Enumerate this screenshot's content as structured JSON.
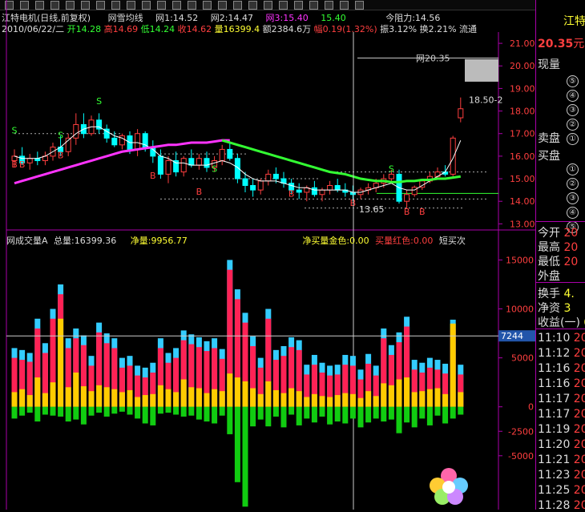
{
  "toolbar": {
    "button_count": 24
  },
  "header": {
    "stock_name": "江特电机(日线,前复权)",
    "indicator_name": "网雪均线",
    "w1": "网1:14.52",
    "w2": "网2:14.47",
    "w3": "网3:15.40",
    "w4": "15.40",
    "resist": "今阻力:14.56",
    "date": "2010/06/22/二",
    "open": "开14.28",
    "high": "高14.69",
    "low": "低14.24",
    "close": "收14.62",
    "volume": "量16399.4",
    "amount": "额2384.6万",
    "change": "幅0.19(1.32%)",
    "amplitude": "振3.12%",
    "turnover": "换2.21%",
    "flow": "流通"
  },
  "lower_header": {
    "name": "网成交量A",
    "total": "总量:16399.36",
    "net": "净量:9956.77",
    "buy": "净买量金色:0.00",
    "sell": "买量红色:0.00",
    "short": "短买次"
  },
  "right_panel": {
    "title": "江特",
    "price": "20.35",
    "unit": "元",
    "now_vol": "现量",
    "ask": "卖盘",
    "bid": "买盘",
    "levels": [
      "⑤",
      "④",
      "③",
      "②",
      "①"
    ],
    "bid_levels": [
      "①",
      "②",
      "③",
      "④",
      "⑤"
    ],
    "today_open": "今开",
    "today_open_v": "20",
    "high": "最高",
    "high_v": "20",
    "low": "最低",
    "low_v": "20",
    "outer": "外盘",
    "outer_v": "",
    "turnover": "换手",
    "turnover_v": "4.",
    "netasset": "净资",
    "netasset_v": "3",
    "earn": "收益(一)",
    "earn_v": "0",
    "ticks": [
      "11:10",
      "11:12",
      "11:16",
      "11:16",
      "11:17",
      "11:17",
      "11:19",
      "11:20",
      "11:21",
      "11:23",
      "11:25",
      "11:28"
    ],
    "tick_vals": [
      "20",
      "20",
      "20",
      "20",
      "20",
      "20",
      "20",
      "20",
      "20",
      "20",
      "20",
      "20"
    ]
  },
  "colors": {
    "up": "#ff3f3f",
    "down": "#00ffff",
    "ma_green": "#33ff33",
    "ma_magenta": "#ff33ff",
    "vol_cyan": "#33ccff",
    "vol_red": "#ff2255",
    "vol_gold": "#ffcc00",
    "vol_green": "#11cc11"
  },
  "chart_data": [
    {
      "type": "candlestick",
      "title": "江特电机(日线,前复权)",
      "ylim": [
        12.8,
        21.5
      ],
      "y_ticks": [
        13.0,
        14.0,
        15.0,
        16.0,
        17.0,
        18.0,
        19.0,
        20.0,
        21.0
      ],
      "annotations": [
        "网20.35",
        "18.50-2",
        "13.65"
      ],
      "candles": [
        [
          15.8,
          16.3,
          15.5,
          16.0
        ],
        [
          16.0,
          16.4,
          15.6,
          15.7
        ],
        [
          15.7,
          16.1,
          15.4,
          15.9
        ],
        [
          15.9,
          16.2,
          15.6,
          15.8
        ],
        [
          15.8,
          16.2,
          15.6,
          16.0
        ],
        [
          16.0,
          16.6,
          15.8,
          16.4
        ],
        [
          16.4,
          16.9,
          16.0,
          16.2
        ],
        [
          16.2,
          17.0,
          16.0,
          16.8
        ],
        [
          16.8,
          17.9,
          16.5,
          17.4
        ],
        [
          17.4,
          17.9,
          16.8,
          17.0
        ],
        [
          17.0,
          17.8,
          16.9,
          17.6
        ],
        [
          17.6,
          17.9,
          17.0,
          17.2
        ],
        [
          17.2,
          17.4,
          16.6,
          16.8
        ],
        [
          16.8,
          17.1,
          16.4,
          16.5
        ],
        [
          16.5,
          17.0,
          16.3,
          16.9
        ],
        [
          16.9,
          17.1,
          16.1,
          16.3
        ],
        [
          16.3,
          17.2,
          16.0,
          17.0
        ],
        [
          17.0,
          17.1,
          16.2,
          16.4
        ],
        [
          16.4,
          16.7,
          15.7,
          16.0
        ],
        [
          16.0,
          16.3,
          15.0,
          15.2
        ],
        [
          15.2,
          16.0,
          14.8,
          15.8
        ],
        [
          15.8,
          16.2,
          15.1,
          15.3
        ],
        [
          15.3,
          16.0,
          15.1,
          15.9
        ],
        [
          15.9,
          16.3,
          15.5,
          15.6
        ],
        [
          15.6,
          16.1,
          15.4,
          15.9
        ],
        [
          15.9,
          16.2,
          15.3,
          15.5
        ],
        [
          15.5,
          16.0,
          15.3,
          15.8
        ],
        [
          15.8,
          16.5,
          15.6,
          16.3
        ],
        [
          16.3,
          16.6,
          15.8,
          15.9
        ],
        [
          15.9,
          16.1,
          14.8,
          15.0
        ],
        [
          15.0,
          15.3,
          14.4,
          14.7
        ],
        [
          14.7,
          15.0,
          14.2,
          14.5
        ],
        [
          14.5,
          15.0,
          14.3,
          14.9
        ],
        [
          14.9,
          15.4,
          14.7,
          15.2
        ],
        [
          15.2,
          15.5,
          14.8,
          15.0
        ],
        [
          15.0,
          15.3,
          14.6,
          14.8
        ],
        [
          14.8,
          15.0,
          14.3,
          14.5
        ],
        [
          14.5,
          14.8,
          14.1,
          14.4
        ],
        [
          14.4,
          14.7,
          14.0,
          14.6
        ],
        [
          14.6,
          14.9,
          14.2,
          14.3
        ],
        [
          14.3,
          14.6,
          14.0,
          14.5
        ],
        [
          14.5,
          14.9,
          14.3,
          14.7
        ],
        [
          14.7,
          15.0,
          14.4,
          14.5
        ],
        [
          14.5,
          14.8,
          14.2,
          14.4
        ],
        [
          14.4,
          14.7,
          14.0,
          14.3
        ],
        [
          14.3,
          14.6,
          14.1,
          14.5
        ],
        [
          14.5,
          14.8,
          14.3,
          14.6
        ],
        [
          14.6,
          15.0,
          14.4,
          14.8
        ],
        [
          14.8,
          15.2,
          14.6,
          15.0
        ],
        [
          15.0,
          15.4,
          14.8,
          15.2
        ],
        [
          15.2,
          15.4,
          13.9,
          14.0
        ],
        [
          14.0,
          14.5,
          13.65,
          14.3
        ],
        [
          14.3,
          14.7,
          14.2,
          14.62
        ],
        [
          14.62,
          15.0,
          14.5,
          14.9
        ],
        [
          14.9,
          15.3,
          14.8,
          15.1
        ],
        [
          15.1,
          15.5,
          15.0,
          15.3
        ],
        [
          15.3,
          15.6,
          15.1,
          15.2
        ],
        [
          15.2,
          16.9,
          15.1,
          16.8
        ],
        [
          17.7,
          18.6,
          17.5,
          18.1
        ]
      ],
      "ma_white": [
        16.0,
        15.9,
        15.9,
        15.9,
        16.0,
        16.2,
        16.4,
        16.7,
        17.0,
        17.2,
        17.3,
        17.3,
        17.1,
        16.9,
        16.8,
        16.6,
        16.6,
        16.5,
        16.3,
        16.0,
        15.9,
        15.7,
        15.7,
        15.6,
        15.6,
        15.6,
        15.7,
        15.8,
        15.7,
        15.5,
        15.2,
        15.0,
        14.9,
        14.9,
        14.9,
        14.8,
        14.7,
        14.6,
        14.6,
        14.5,
        14.5,
        14.5,
        14.5,
        14.5,
        14.4,
        14.4,
        14.5,
        14.6,
        14.7,
        14.8,
        14.6,
        14.5,
        14.5,
        14.7,
        14.9,
        15.1,
        15.3,
        15.9,
        16.7
      ],
      "ma_magenta": [
        14.8,
        14.9,
        15.0,
        15.1,
        15.2,
        15.3,
        15.4,
        15.5,
        15.6,
        15.7,
        15.8,
        15.9,
        16.0,
        16.1,
        16.2,
        16.25,
        16.3,
        16.35,
        16.4,
        16.45,
        16.5,
        16.5,
        16.55,
        16.6,
        16.6,
        16.6,
        16.65,
        16.7,
        16.7
      ],
      "ma_green": [
        16.7,
        16.6,
        16.5,
        16.4,
        16.3,
        16.2,
        16.1,
        16.0,
        15.9,
        15.8,
        15.7,
        15.6,
        15.5,
        15.4,
        15.3,
        15.25,
        15.2,
        15.1,
        15.0,
        14.95,
        14.9,
        14.9,
        14.85,
        14.85,
        14.9,
        14.9,
        14.95,
        14.95,
        15.0,
        15.0,
        15.05,
        15.1
      ],
      "signals_S": [
        [
          0,
          17.0
        ],
        [
          11,
          18.3
        ],
        [
          6,
          16.8
        ],
        [
          26,
          15.3
        ],
        [
          49,
          15.3
        ]
      ],
      "signals_B": [
        [
          0,
          15.5
        ],
        [
          1,
          15.5
        ],
        [
          6,
          15.9
        ],
        [
          18,
          15.0
        ],
        [
          24,
          14.3
        ],
        [
          36,
          14.2
        ],
        [
          44,
          13.8
        ],
        [
          51,
          13.4
        ],
        [
          53,
          13.4
        ]
      ]
    },
    {
      "type": "bar",
      "title": "网成交量A",
      "ylim": [
        -10500,
        17000
      ],
      "y_ticks": [
        15000,
        10000,
        5000,
        0,
        -2500,
        -5000
      ],
      "highlight_label": "7244",
      "cyan": [
        6000,
        5800,
        5500,
        9000,
        6500,
        10000,
        12500,
        7000,
        8000,
        7300,
        5200,
        8600,
        7500,
        7000,
        5000,
        5200,
        4200,
        4000,
        4500,
        7000,
        5500,
        6000,
        7800,
        7400,
        7100,
        6700,
        7000,
        5900,
        15000,
        12000,
        9600,
        7200,
        5000,
        10000,
        5800,
        6200,
        7100,
        6800,
        4300,
        5300,
        4500,
        4200,
        4300,
        5300,
        5200,
        3800,
        5400,
        4200,
        8000,
        6300,
        7600,
        9200,
        4800,
        4500,
        5000,
        4800,
        4400,
        8900,
        4300
      ],
      "red": [
        5000,
        4800,
        4600,
        8000,
        5500,
        9000,
        11500,
        6000,
        7000,
        6300,
        4200,
        7600,
        6500,
        6000,
        4000,
        4200,
        3200,
        3000,
        3500,
        6000,
        4500,
        5000,
        6800,
        6400,
        6100,
        5700,
        6000,
        4900,
        14000,
        11000,
        8600,
        6200,
        4000,
        9000,
        4800,
        5200,
        6100,
        5800,
        3300,
        4300,
        3500,
        3200,
        3300,
        4300,
        4200,
        2800,
        4400,
        3200,
        7000,
        5300,
        6600,
        8200,
        3800,
        3500,
        4000,
        3800,
        3400,
        7900,
        3300
      ],
      "gold": [
        1500,
        1800,
        1200,
        3000,
        1400,
        2500,
        9000,
        2000,
        3500,
        2100,
        1600,
        2200,
        2000,
        1800,
        1500,
        1700,
        1000,
        1200,
        1300,
        2200,
        1800,
        1500,
        2800,
        2000,
        1900,
        1400,
        1800,
        1600,
        3400,
        3000,
        2600,
        1900,
        1300,
        2600,
        1700,
        1400,
        1900,
        1600,
        1000,
        1300,
        1100,
        1000,
        1200,
        1400,
        1300,
        900,
        1600,
        1100,
        2400,
        2200,
        2800,
        3000,
        1500,
        1600,
        1800,
        1900,
        1300,
        8500,
        1500
      ],
      "green": [
        -1200,
        -900,
        -600,
        -1500,
        -800,
        -900,
        -1000,
        -1500,
        -1300,
        -1800,
        -900,
        -600,
        -1000,
        -700,
        -500,
        -800,
        -1200,
        -1700,
        -1900,
        -700,
        -600,
        -800,
        -1000,
        -900,
        -1300,
        -1500,
        -1700,
        -900,
        -2800,
        -7700,
        -10200,
        -2000,
        -1300,
        -2000,
        -1000,
        -2100,
        -800,
        -1900,
        -1200,
        -1600,
        -1000,
        -1800,
        -1500,
        -1700,
        -1200,
        -2100,
        -1600,
        -1200,
        -1500,
        -1300,
        -2700,
        -1600,
        -2100,
        -1200,
        -1900,
        -900,
        -1700,
        -1200,
        -800
      ]
    }
  ]
}
